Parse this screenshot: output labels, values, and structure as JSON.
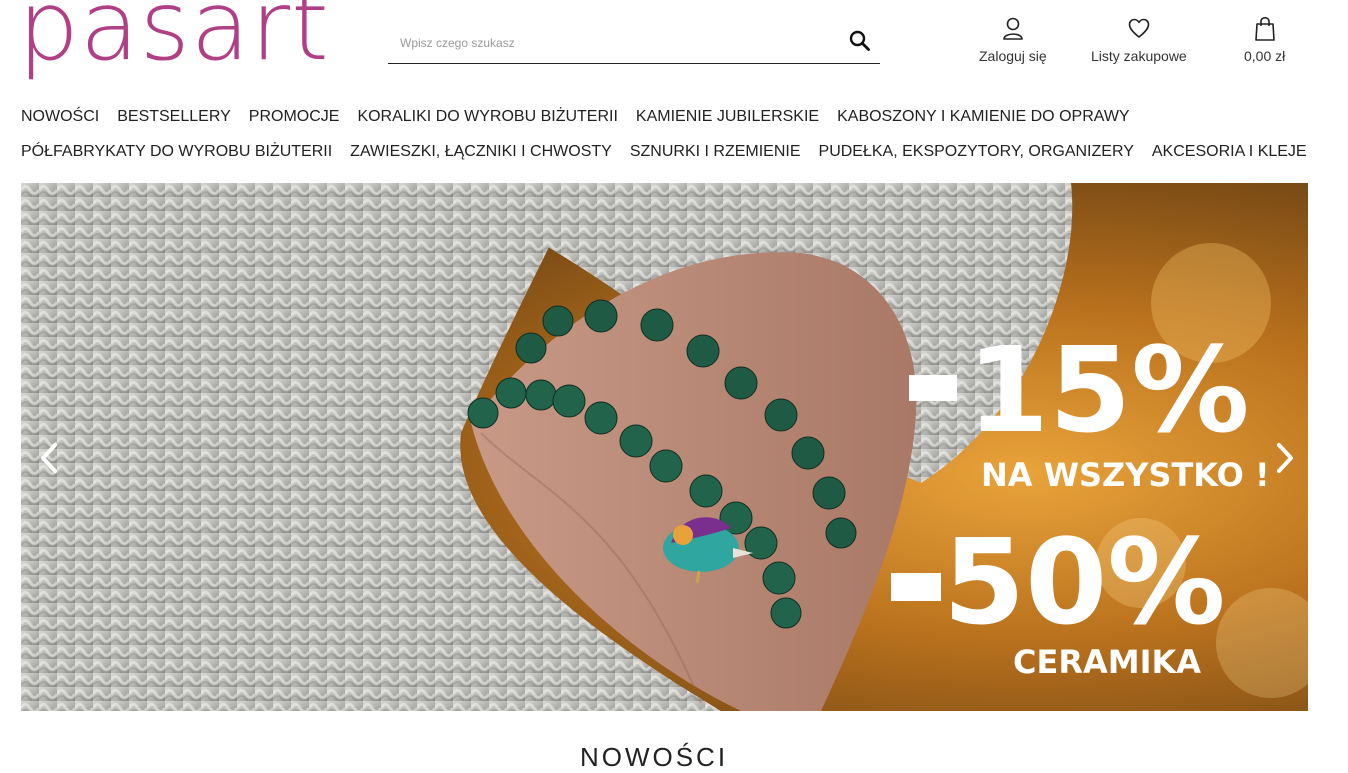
{
  "brand": {
    "logo_text": "pasart",
    "color": "#b13f86"
  },
  "search": {
    "placeholder": "Wpisz czego szukasz",
    "icon": "search-icon"
  },
  "header_actions": {
    "login": {
      "label": "Zaloguj się",
      "icon": "user-icon"
    },
    "wishlist": {
      "label": "Listy zakupowe",
      "icon": "heart-icon"
    },
    "cart": {
      "label": "0,00 zł",
      "icon": "shopping-bag-icon"
    }
  },
  "nav": {
    "row1": [
      "NOWOŚCI",
      "BESTSELLERY",
      "PROMOCJE",
      "KORALIKI DO WYROBU BIŻUTERII",
      "KAMIENIE JUBILERSKIE",
      "KABOSZONY I KAMIENIE DO OPRAWY"
    ],
    "row2": [
      "PÓŁFABRYKATY DO WYROBU BIŻUTERII",
      "ZAWIESZKI, ŁĄCZNIKI I CHWOSTY",
      "SZNURKI I RZEMIENIE",
      "PUDEŁKA, EKSPOZYTORY, ORGANIZERY",
      "AKCESORIA I KLEJE"
    ]
  },
  "banner": {
    "promo1_value": "15%",
    "promo1_text": "NA WSZYSTKO !",
    "promo2_value": "50%",
    "promo2_text": "CERAMIKA",
    "prev_icon": "chevron-left-icon",
    "next_icon": "chevron-right-icon"
  },
  "section": {
    "title": "NOWOŚCI"
  }
}
